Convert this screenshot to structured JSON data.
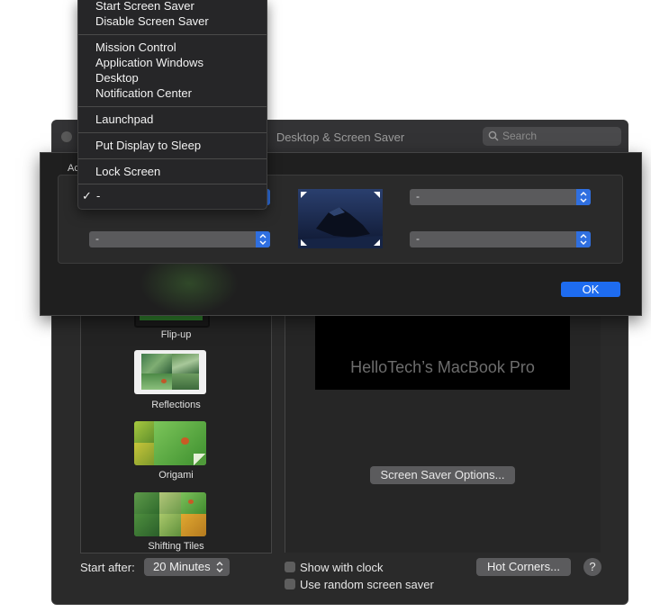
{
  "window": {
    "title": "Desktop & Screen Saver",
    "search_placeholder": "Search"
  },
  "screen_savers": [
    {
      "label": "Flip-up"
    },
    {
      "label": "Reflections"
    },
    {
      "label": "Origami"
    },
    {
      "label": "Shifting Tiles"
    }
  ],
  "preview": {
    "text": "HelloTech’s MacBook Pro",
    "options_button": "Screen Saver Options..."
  },
  "bottom": {
    "start_after_label": "Start after:",
    "start_after_value": "20 Minutes",
    "show_clock_label": "Show with clock",
    "random_saver_label": "Use random screen saver",
    "hot_corners_button": "Hot Corners...",
    "help_button": "?"
  },
  "hot_corners": {
    "truncated_label": "Ac",
    "top_left_value": "-",
    "top_right_value": "-",
    "bottom_left_value": "-",
    "bottom_right_value": "-",
    "ok_button": "OK"
  },
  "menu": {
    "items": [
      "Start Screen Saver",
      "Disable Screen Saver",
      "Mission Control",
      "Application Windows",
      "Desktop",
      "Notification Center",
      "Launchpad",
      "Put Display to Sleep",
      "Lock Screen"
    ],
    "checkmark": "✓",
    "selected_item": "-"
  },
  "colors": {
    "accent": "#1e6cf0",
    "window_bg": "#2a2a2a",
    "menu_bg": "#262628"
  }
}
